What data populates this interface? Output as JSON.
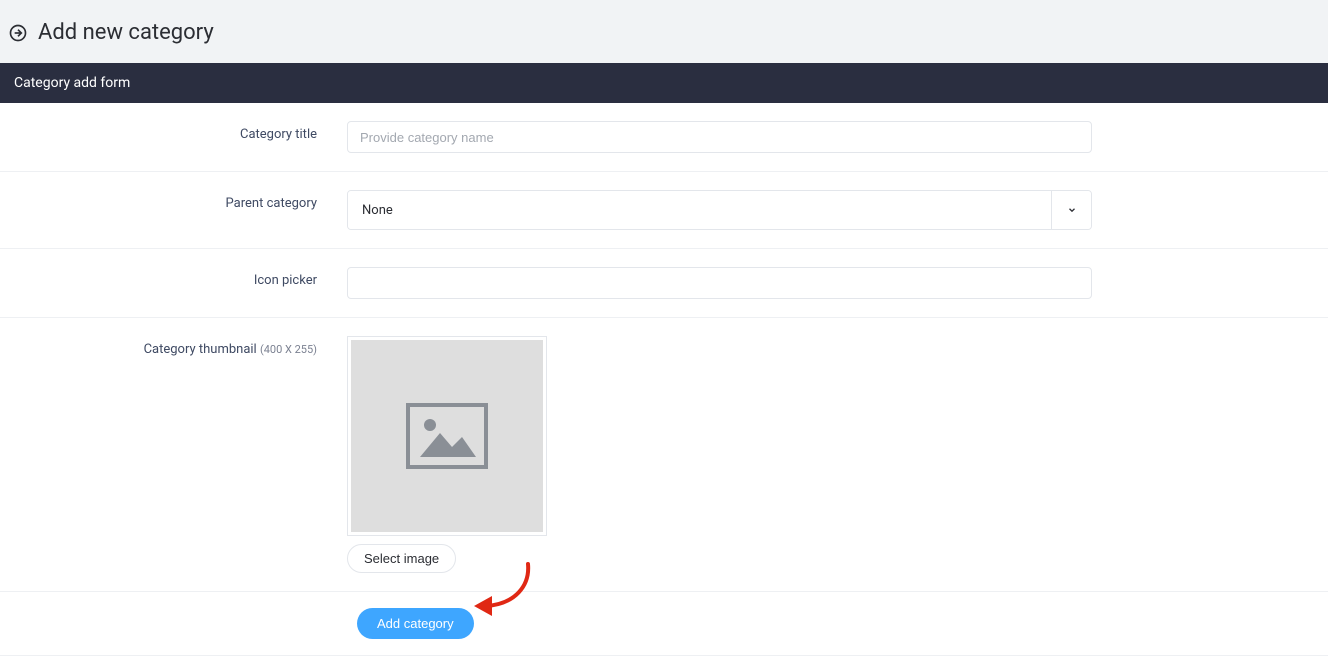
{
  "header": {
    "title": "Add new category"
  },
  "panel": {
    "title": "Category add form"
  },
  "form": {
    "category_title": {
      "label": "Category title",
      "value": "",
      "placeholder": "Provide category name"
    },
    "parent_category": {
      "label": "Parent category",
      "selected": "None"
    },
    "icon_picker": {
      "label": "Icon picker",
      "value": ""
    },
    "thumbnail": {
      "label": "Category thumbnail",
      "size_note": "(400 X 255)",
      "select_button": "Select image"
    },
    "submit_label": "Add category"
  }
}
